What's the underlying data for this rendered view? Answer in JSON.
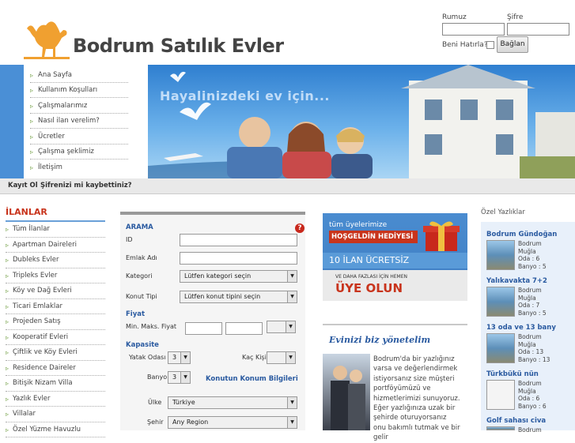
{
  "header": {
    "site_title": "Bodrum Satılık Evler",
    "login": {
      "username_label": "Rumuz",
      "password_label": "Şifre",
      "remember_label": "Beni Hatırla?",
      "submit_label": "Bağlan"
    }
  },
  "nav": {
    "items": [
      {
        "label": "Ana Sayfa"
      },
      {
        "label": "Kullanım Koşulları"
      },
      {
        "label": "Çalışmalarımız"
      },
      {
        "label": "Nasıl ilan verelim?"
      },
      {
        "label": "Ücretler"
      },
      {
        "label": "Çalışma şeklimiz"
      },
      {
        "label": "İletişim"
      }
    ]
  },
  "banner": {
    "headline": "Hayalinizdeki ev için..."
  },
  "subnav": {
    "register_label": "Kayıt Ol",
    "forgot_label": "Şifrenizi mi kaybettiniz?"
  },
  "listings": {
    "title": "İLANLAR",
    "categories": [
      "Tüm İlanlar",
      "Apartman Daireleri",
      "Dubleks Evler",
      "Tripleks Evler",
      "Köy ve Dağ Evleri",
      "Ticari Emlaklar",
      "Projeden Satış",
      "Kooperatif Evleri",
      "Çiftlik ve Köy Evleri",
      "Residence Daireler",
      "Bitişik Nizam Villa",
      "Yazlık Evler",
      "Villalar",
      "Özel Yüzme Havuzlu"
    ]
  },
  "search": {
    "title": "ARAMA",
    "id_label": "ID",
    "emlak_label": "Emlak Adı",
    "kategori_label": "Kategori",
    "kategori_value": "Lütfen kategori seçin",
    "konut_label": "Konut Tipi",
    "konut_value": "Lütfen konut tipini seçin",
    "fiyat_title": "Fiyat",
    "fiyat_label": "Min. Maks. Fiyat",
    "kapasite_title": "Kapasite",
    "yatak_label": "Yatak Odası",
    "yatak_value": "3",
    "kac_kisi_label": "Kaç Kişi",
    "banyo_label": "Banyo",
    "banyo_value": "3",
    "location_link": "Konutun Konum Bilgileri",
    "ulke_label": "Ülke",
    "ulke_value": "Türkiye",
    "sehir_label": "Şehir",
    "sehir_value": "Any Region"
  },
  "promo": {
    "line1": "tüm üyelerimize",
    "line2": "HOŞGELDİN HEDİYESİ",
    "line3": "10 İLAN ÜCRETSİZ",
    "line4": "VE DAHA FAZLASI İÇİN HEMEN",
    "line5": "ÜYE OLUN",
    "section_title": "Evinizi biz yönetelim",
    "section_text": "Bodrum'da bir yazlığınız varsa ve değerlendirmek istiyorsanız size müşteri portföyümüzü ve hizmetlerimizi sunuyoruz. Eğer yazlığınıza uzak bir şehirde oturuyorsanız onu bakımlı tutmak ve bir gelir"
  },
  "special": {
    "title": "Özel Yazlıklar",
    "items": [
      {
        "name": "Bodrum Gündoğan",
        "city": "Bodrum",
        "region": "Muğla",
        "rooms": "Oda : 6",
        "baths": "Banyo : 5"
      },
      {
        "name": "Yalıkavakta 7+2",
        "city": "Bodrum",
        "region": "Muğla",
        "rooms": "Oda : 7",
        "baths": "Banyo : 5"
      },
      {
        "name": "13 oda ve 13 bany",
        "city": "Bodrum",
        "region": "Muğla",
        "rooms": "Oda : 13",
        "baths": "Banyo : 13"
      },
      {
        "name": "Türkbükü nün",
        "city": "Bodrum",
        "region": "Muğla",
        "rooms": "Oda : 6",
        "baths": "Banyo : 6"
      },
      {
        "name": "Golf sahası civa",
        "city": "Bodrum",
        "region": "",
        "rooms": "",
        "baths": ""
      }
    ]
  },
  "colors": {
    "brand_blue": "#3c7fbf",
    "accent_red": "#c8341c",
    "link_blue": "#2a5aa0",
    "camel_orange": "#f0a030"
  }
}
